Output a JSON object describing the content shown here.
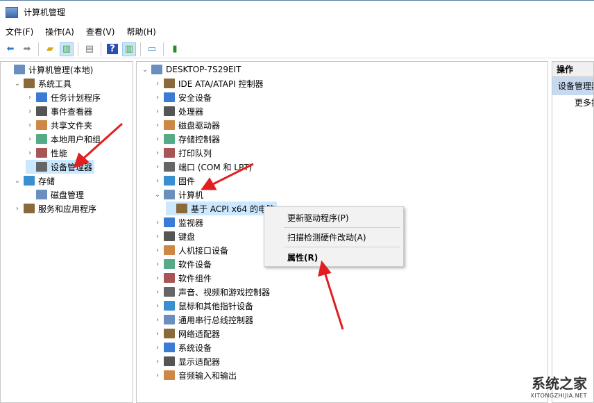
{
  "window": {
    "title": "计算机管理"
  },
  "menu": [
    "文件(F)",
    "操作(A)",
    "查看(V)",
    "帮助(H)"
  ],
  "toolbar": [
    "back-icon",
    "forward-icon",
    "up-folder-icon",
    "show-hide-tree-icon",
    "properties-icon",
    "help-icon",
    "show-action-pane-icon",
    "scan-icon",
    "update-driver-icon"
  ],
  "left_tree": [
    {
      "label": "计算机管理(本地)",
      "level": 0,
      "chev": ""
    },
    {
      "label": "系统工具",
      "level": 1,
      "chev": "v"
    },
    {
      "label": "任务计划程序",
      "level": 2,
      "chev": ">"
    },
    {
      "label": "事件查看器",
      "level": 2,
      "chev": ">"
    },
    {
      "label": "共享文件夹",
      "level": 2,
      "chev": ">"
    },
    {
      "label": "本地用户和组",
      "level": 2,
      "chev": ">"
    },
    {
      "label": "性能",
      "level": 2,
      "chev": ">"
    },
    {
      "label": "设备管理器",
      "level": 2,
      "chev": "",
      "selected": true
    },
    {
      "label": "存储",
      "level": 1,
      "chev": "v"
    },
    {
      "label": "磁盘管理",
      "level": 2,
      "chev": ""
    },
    {
      "label": "服务和应用程序",
      "level": 1,
      "chev": ">"
    }
  ],
  "device_tree": {
    "root": "DESKTOP-7S29EIT",
    "items": [
      {
        "label": "IDE ATA/ATAPI 控制器",
        "chev": ">"
      },
      {
        "label": "安全设备",
        "chev": ">"
      },
      {
        "label": "处理器",
        "chev": ">"
      },
      {
        "label": "磁盘驱动器",
        "chev": ">"
      },
      {
        "label": "存储控制器",
        "chev": ">"
      },
      {
        "label": "打印队列",
        "chev": ">"
      },
      {
        "label": "端口 (COM 和 LPT)",
        "chev": ">"
      },
      {
        "label": "固件",
        "chev": ">"
      },
      {
        "label": "计算机",
        "chev": "v"
      },
      {
        "label": "基于 ACPI x64 的电脑",
        "chev": "",
        "child": true,
        "selected": true
      },
      {
        "label": "监视器",
        "chev": ">"
      },
      {
        "label": "键盘",
        "chev": ">"
      },
      {
        "label": "人机接口设备",
        "chev": ">"
      },
      {
        "label": "软件设备",
        "chev": ">"
      },
      {
        "label": "软件组件",
        "chev": ">"
      },
      {
        "label": "声音、视频和游戏控制器",
        "chev": ">"
      },
      {
        "label": "鼠标和其他指针设备",
        "chev": ">"
      },
      {
        "label": "通用串行总线控制器",
        "chev": ">"
      },
      {
        "label": "网络适配器",
        "chev": ">"
      },
      {
        "label": "系统设备",
        "chev": ">"
      },
      {
        "label": "显示适配器",
        "chev": ">"
      },
      {
        "label": "音频输入和输出",
        "chev": ">"
      }
    ]
  },
  "context_menu": {
    "update": "更新驱动程序(P)",
    "scan": "扫描检测硬件改动(A)",
    "properties": "属性(R)"
  },
  "actions": {
    "header": "操作",
    "selected": "设备管理器",
    "more": "更多操作"
  },
  "watermark": {
    "name": "系统之家",
    "url": "XITONGZHIJIA.NET"
  },
  "colors": {
    "selection": "#cce8ff",
    "arrow": "#e02020"
  }
}
